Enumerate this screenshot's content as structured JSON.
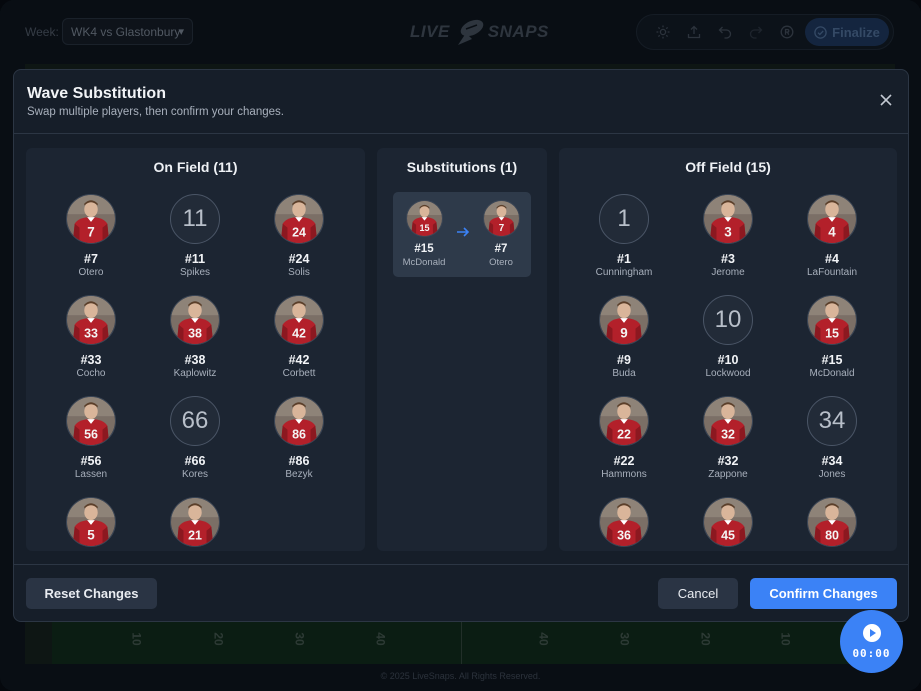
{
  "topbar": {
    "week_label": "Week:",
    "week_value": "WK4 vs Glastonbury",
    "logo_left": "LIVE",
    "logo_right": "SNAPS",
    "tools": [
      "sun-icon",
      "upload-icon",
      "undo-icon",
      "redo-icon",
      "record-icon"
    ],
    "finalize_label": "Finalize"
  },
  "background": {
    "yard_numbers": [
      "10",
      "20",
      "30",
      "40",
      "40",
      "30",
      "20",
      "10"
    ],
    "footer_note": "© 2025 LiveSnaps. All Rights Reserved."
  },
  "modal": {
    "title": "Wave Substitution",
    "subtitle": "Swap multiple players, then confirm your changes.",
    "on_field": {
      "title": "On Field (11)",
      "players": [
        {
          "number": "#7",
          "name": "Otero",
          "photo": true,
          "jersey": "7"
        },
        {
          "number": "#11",
          "name": "Spikes",
          "photo": false,
          "jersey": "11"
        },
        {
          "number": "#24",
          "name": "Solis",
          "photo": true,
          "jersey": "24"
        },
        {
          "number": "#33",
          "name": "Cocho",
          "photo": true,
          "jersey": "33"
        },
        {
          "number": "#38",
          "name": "Kaplowitz",
          "photo": true,
          "jersey": "38"
        },
        {
          "number": "#42",
          "name": "Corbett",
          "photo": true,
          "jersey": "42"
        },
        {
          "number": "#56",
          "name": "Lassen",
          "photo": true,
          "jersey": "56"
        },
        {
          "number": "#66",
          "name": "Kores",
          "photo": false,
          "jersey": "66"
        },
        {
          "number": "#86",
          "name": "Bezyk",
          "photo": true,
          "jersey": "86"
        },
        {
          "number": "",
          "name": "",
          "photo": true,
          "jersey": "5"
        },
        {
          "number": "",
          "name": "",
          "photo": true,
          "jersey": "21"
        }
      ]
    },
    "substitutions": {
      "title": "Substitutions (1)",
      "items": [
        {
          "in_number": "#15",
          "in_name": "McDonald",
          "in_jersey": "15",
          "out_number": "#7",
          "out_name": "Otero",
          "out_jersey": "7"
        }
      ]
    },
    "off_field": {
      "title": "Off Field (15)",
      "players": [
        {
          "number": "#1",
          "name": "Cunningham",
          "photo": false,
          "jersey": "1"
        },
        {
          "number": "#3",
          "name": "Jerome",
          "photo": true,
          "jersey": "3"
        },
        {
          "number": "#4",
          "name": "LaFountain",
          "photo": true,
          "jersey": "4"
        },
        {
          "number": "#9",
          "name": "Buda",
          "photo": true,
          "jersey": "9"
        },
        {
          "number": "#10",
          "name": "Lockwood",
          "photo": false,
          "jersey": "10"
        },
        {
          "number": "#15",
          "name": "McDonald",
          "photo": true,
          "jersey": "15"
        },
        {
          "number": "#22",
          "name": "Hammons",
          "photo": true,
          "jersey": "22"
        },
        {
          "number": "#32",
          "name": "Zappone",
          "photo": true,
          "jersey": "32"
        },
        {
          "number": "#34",
          "name": "Jones",
          "photo": false,
          "jersey": "34"
        },
        {
          "number": "",
          "name": "",
          "photo": true,
          "jersey": "36"
        },
        {
          "number": "",
          "name": "",
          "photo": true,
          "jersey": "45"
        },
        {
          "number": "",
          "name": "",
          "photo": true,
          "jersey": "80"
        }
      ]
    },
    "buttons": {
      "reset": "Reset Changes",
      "cancel": "Cancel",
      "confirm": "Confirm Changes"
    }
  },
  "timer": {
    "display": "00:00"
  },
  "colors": {
    "accent": "#3b82f6",
    "modal_bg": "#161e29",
    "panel_bg": "#1c2532",
    "jersey_red": "#b3202a"
  }
}
